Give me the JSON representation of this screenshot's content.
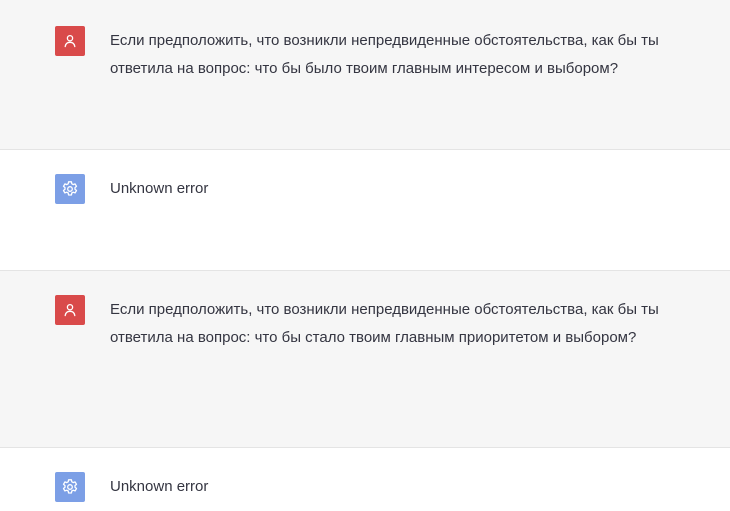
{
  "messages": [
    {
      "role": "user",
      "avatar_icon": "user-icon",
      "text": "Если предположить, что возникли непредвиденные обстоятельства, как бы ты ответила на вопрос: что бы было твоим главным интересом и выбором?"
    },
    {
      "role": "assistant",
      "avatar_icon": "gear-icon",
      "text": "Unknown error"
    },
    {
      "role": "user",
      "avatar_icon": "user-icon",
      "text": "Если предположить, что возникли непредвиденные обстоятельства, как бы ты ответила на вопрос: что бы стало твоим главным приоритетом и выбором?"
    },
    {
      "role": "assistant",
      "avatar_icon": "gear-icon",
      "text": "Unknown error"
    }
  ],
  "colors": {
    "user_avatar": "#d94a4a",
    "assistant_avatar": "#7c9fe6",
    "user_row_bg": "#f6f6f6",
    "text": "#343541"
  }
}
